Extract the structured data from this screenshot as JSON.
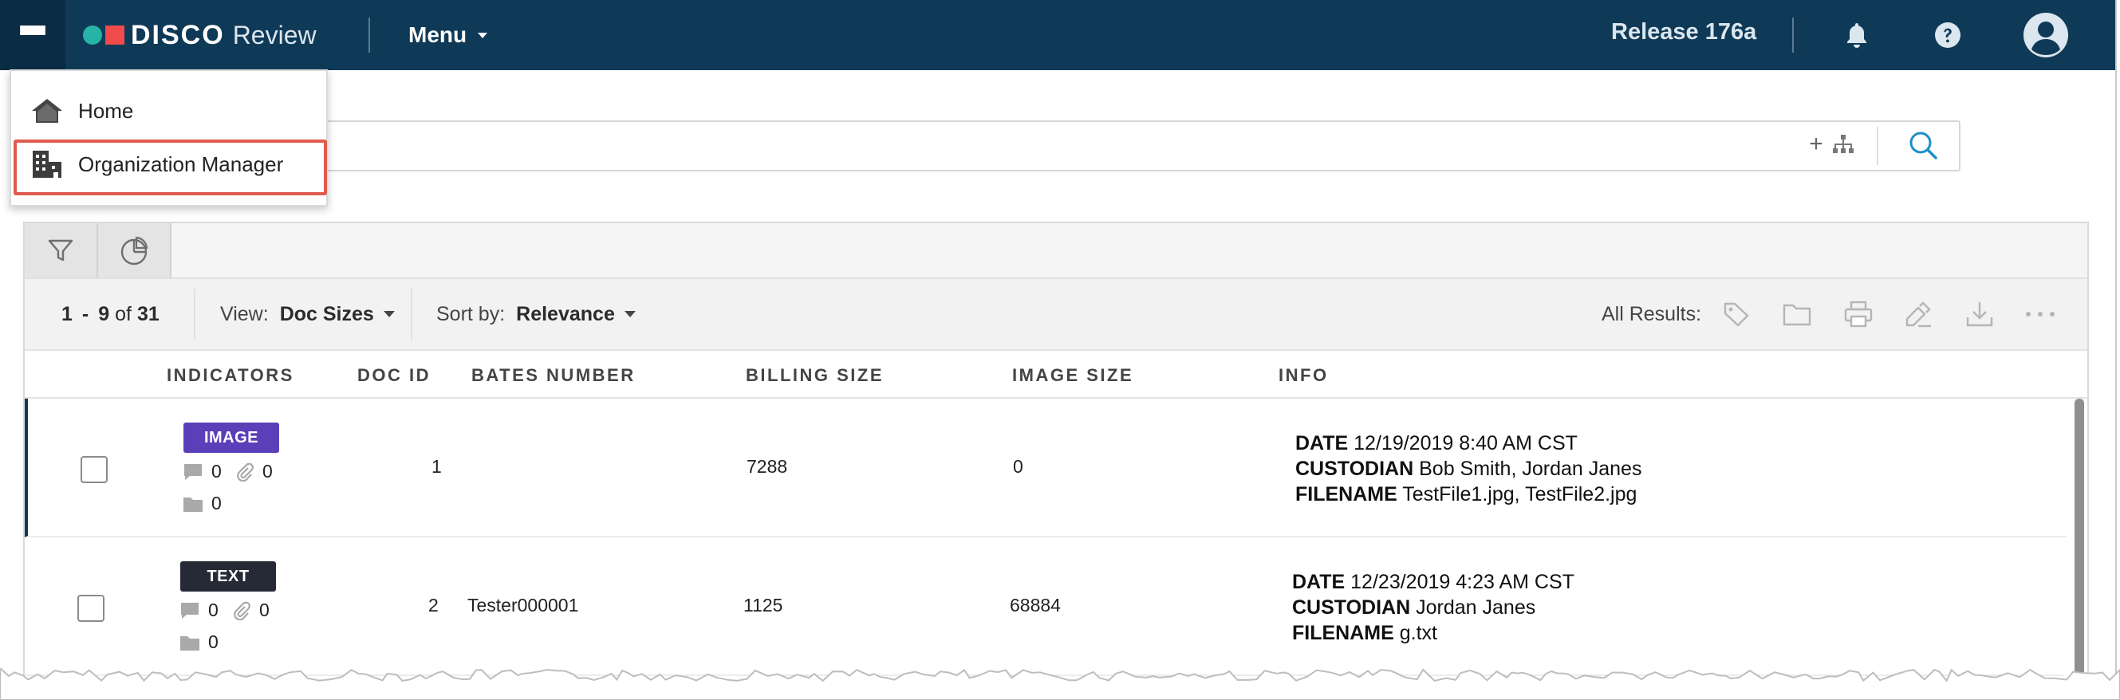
{
  "header": {
    "brand_name": "DISCO",
    "brand_sub": "Review",
    "menu_label": "Menu",
    "release": "Release 176a",
    "icons": [
      "hamburger-icon",
      "bell-icon",
      "help-icon",
      "user-avatar-icon"
    ]
  },
  "dropdown": {
    "items": [
      {
        "label": "Home",
        "icon": "home-icon"
      },
      {
        "label": "Organization Manager",
        "icon": "organization-icon"
      }
    ],
    "highlighted": "Organization Manager"
  },
  "search": {
    "icons": [
      "plus-icon",
      "hierarchy-icon",
      "search-icon"
    ]
  },
  "panel": {
    "tab_icons": [
      "filter-icon",
      "pie-chart-icon"
    ]
  },
  "toolbar": {
    "range_start": "1",
    "range_dash": "-",
    "range_end": "9",
    "range_of": "of",
    "total": "31",
    "view_label": "View:",
    "view_value": "Doc Sizes",
    "sort_label": "Sort by:",
    "sort_value": "Relevance",
    "all_results_label": "All Results:",
    "action_icons": [
      "tag-icon",
      "folder-icon",
      "print-icon",
      "redact-icon",
      "download-icon",
      "more-icon"
    ]
  },
  "columns": [
    "INDICATORS",
    "DOC ID",
    "BATES NUMBER",
    "BILLING SIZE",
    "IMAGE SIZE",
    "INFO"
  ],
  "rows": [
    {
      "badge": "IMAGE",
      "badge_color": "#5b3fb8",
      "comments": "0",
      "attachments": "0",
      "folders": "0",
      "doc_id": "1",
      "bates": "",
      "billing_size": "7288",
      "image_size": "0",
      "info_date_label": "DATE",
      "info_date": "12/19/2019 8:40 AM CST",
      "info_custodian_label": "CUSTODIAN",
      "info_custodian": "Bob Smith, Jordan Janes",
      "info_filename_label": "FILENAME",
      "info_filename": "TestFile1.jpg, TestFile2.jpg"
    },
    {
      "badge": "TEXT",
      "badge_color": "#252a36",
      "comments": "0",
      "attachments": "0",
      "folders": "0",
      "doc_id": "2",
      "bates": "Tester000001",
      "billing_size": "1125",
      "image_size": "68884",
      "info_date_label": "DATE",
      "info_date": "12/23/2019 4:23 AM CST",
      "info_custodian_label": "CUSTODIAN",
      "info_custodian": "Jordan Janes",
      "info_filename_label": "FILENAME",
      "info_filename": "g.txt"
    }
  ],
  "colors": {
    "topbar": "#0f3a57",
    "hamburger_bg": "#0a2c44",
    "accent_teal": "#27b3a7",
    "accent_red": "#ef4b4b",
    "highlight_box": "#e05a4f",
    "search_icon": "#1b8fc9"
  }
}
